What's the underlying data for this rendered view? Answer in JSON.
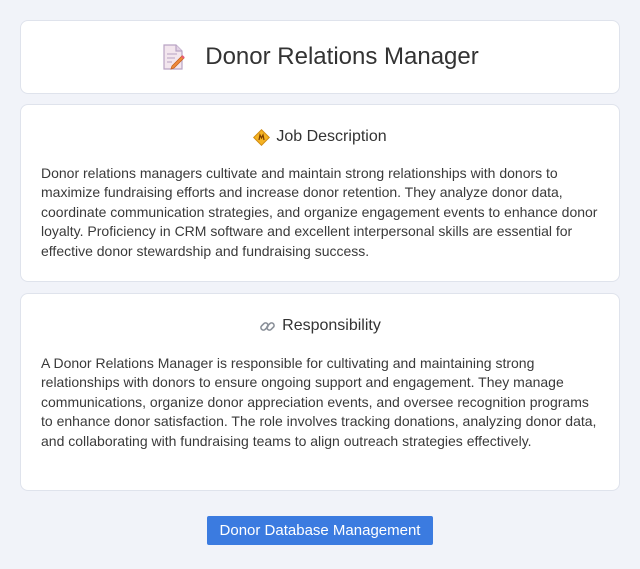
{
  "header": {
    "title": "Donor Relations Manager",
    "icon": "document-edit-icon"
  },
  "job_description": {
    "icon": "diamond-icon",
    "title": "Job Description",
    "body": "Donor relations managers cultivate and maintain strong relationships with donors to maximize fundraising efforts and increase donor retention. They analyze donor data, coordinate communication strategies, and organize engagement events to enhance donor loyalty. Proficiency in CRM software and excellent interpersonal skills are essential for effective donor stewardship and fundraising success."
  },
  "responsibility": {
    "icon": "link-icon",
    "title": "Responsibility",
    "body": "A Donor Relations Manager is responsible for cultivating and maintaining strong relationships with donors to ensure ongoing support and engagement. They manage communications, organize donor appreciation events, and oversee recognition programs to enhance donor satisfaction. The role involves tracking donations, analyzing donor data, and collaborating with fundraising teams to align outreach strategies effectively."
  },
  "tag": {
    "label": "Donor Database Management"
  },
  "colors": {
    "accent": "#3b7be0",
    "background": "#f1f3f9",
    "card": "#ffffff"
  }
}
